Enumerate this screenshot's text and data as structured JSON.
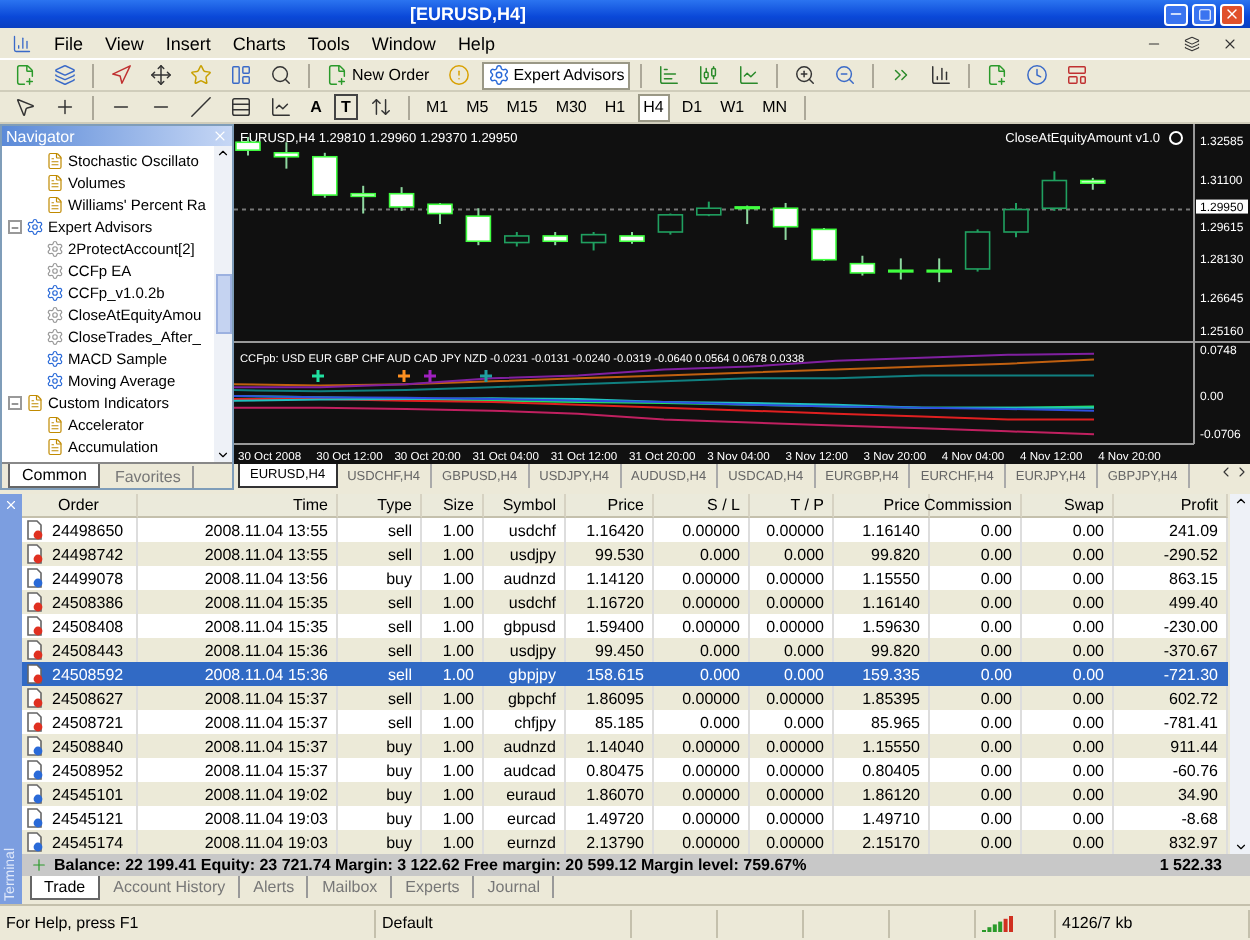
{
  "window": {
    "title": "[EURUSD,H4]"
  },
  "menu": [
    "File",
    "View",
    "Insert",
    "Charts",
    "Tools",
    "Window",
    "Help"
  ],
  "toolbar": {
    "new_order": "New Order",
    "expert_advisors": "Expert Advisors"
  },
  "text_tools": [
    {
      "glyph": "A",
      "boxed": false
    },
    {
      "glyph": "T",
      "boxed": true
    }
  ],
  "timeframes": [
    {
      "label": "M1",
      "selected": false
    },
    {
      "label": "M5",
      "selected": false
    },
    {
      "label": "M15",
      "selected": false
    },
    {
      "label": "M30",
      "selected": false
    },
    {
      "label": "H1",
      "selected": false
    },
    {
      "label": "H4",
      "selected": true
    },
    {
      "label": "D1",
      "selected": false
    },
    {
      "label": "W1",
      "selected": false
    },
    {
      "label": "MN",
      "selected": false
    }
  ],
  "navigator": {
    "title": "Navigator",
    "tree_continued": [
      "Stochastic Oscillato",
      "Volumes",
      "Williams' Percent Ra"
    ],
    "tree": [
      {
        "label": "Expert Advisors",
        "expanded": true,
        "children": [
          {
            "label": "2ProtectAccount[2]",
            "active": false
          },
          {
            "label": "CCFp EA",
            "active": false
          },
          {
            "label": "CCFp_v1.0.2b",
            "active": true
          },
          {
            "label": "CloseAtEquityAmou",
            "active": false
          },
          {
            "label": "CloseTrades_After_",
            "active": false
          },
          {
            "label": "MACD Sample",
            "active": true
          },
          {
            "label": "Moving Average",
            "active": true
          }
        ]
      },
      {
        "label": "Custom Indicators",
        "expanded": true,
        "children": [
          {
            "label": "Accelerator",
            "active": false
          },
          {
            "label": "Accumulation",
            "active": false
          }
        ]
      }
    ],
    "tabs": [
      {
        "label": "Common",
        "selected": true
      },
      {
        "label": "Favorites",
        "selected": false
      }
    ]
  },
  "chart": {
    "header": "EURUSD,H4  1.29810 1.29960 1.29370 1.29950",
    "expert": "CloseAtEquityAmount v1.0",
    "price_labels": [
      "1.32585",
      "1.31100",
      "1.29615",
      "1.28130",
      "1.26645",
      "1.25160"
    ],
    "current_price": "1.29950",
    "indicator": {
      "header": "CCFpb: USD EUR GBP CHF AUD CAD JPY NZD -0.0231 -0.0131 -0.0240 -0.0319 -0.0640 0.0564 0.0678 0.0338",
      "scale": [
        "0.0748",
        "0.00",
        "-0.0706"
      ]
    },
    "time_labels": [
      "30 Oct 2008",
      "30 Oct 12:00",
      "30 Oct 20:00",
      "31 Oct 04:00",
      "31 Oct 12:00",
      "31 Oct 20:00",
      "3 Nov 04:00",
      "3 Nov 12:00",
      "3 Nov 20:00",
      "4 Nov 04:00",
      "4 Nov 12:00",
      "4 Nov 20:00"
    ],
    "tabs": [
      {
        "label": "EURUSD,H4",
        "selected": true
      },
      {
        "label": "USDCHF,H4",
        "selected": false
      },
      {
        "label": "GBPUSD,H4",
        "selected": false
      },
      {
        "label": "USDJPY,H4",
        "selected": false
      },
      {
        "label": "AUDUSD,H4",
        "selected": false
      },
      {
        "label": "USDCAD,H4",
        "selected": false
      },
      {
        "label": "EURGBP,H4",
        "selected": false
      },
      {
        "label": "EURCHF,H4",
        "selected": false
      },
      {
        "label": "EURJPY,H4",
        "selected": false
      },
      {
        "label": "GBPJPY,H4",
        "selected": false
      }
    ]
  },
  "terminal": {
    "side_label": "Terminal",
    "columns": [
      "Order",
      "Time",
      "Type",
      "Size",
      "Symbol",
      "Price",
      "S / L",
      "T / P",
      "Price",
      "Commission",
      "Swap",
      "Profit"
    ],
    "rows": [
      {
        "kind": "sell",
        "selected": false,
        "cells": [
          "24498650",
          "2008.11.04 13:55",
          "sell",
          "1.00",
          "usdchf",
          "1.16420",
          "0.00000",
          "0.00000",
          "1.16140",
          "0.00",
          "0.00",
          "241.09"
        ]
      },
      {
        "kind": "sell",
        "selected": false,
        "cells": [
          "24498742",
          "2008.11.04 13:55",
          "sell",
          "1.00",
          "usdjpy",
          "99.530",
          "0.000",
          "0.000",
          "99.820",
          "0.00",
          "0.00",
          "-290.52"
        ]
      },
      {
        "kind": "buy",
        "selected": false,
        "cells": [
          "24499078",
          "2008.11.04 13:56",
          "buy",
          "1.00",
          "audnzd",
          "1.14120",
          "0.00000",
          "0.00000",
          "1.15550",
          "0.00",
          "0.00",
          "863.15"
        ]
      },
      {
        "kind": "sell",
        "selected": false,
        "cells": [
          "24508386",
          "2008.11.04 15:35",
          "sell",
          "1.00",
          "usdchf",
          "1.16720",
          "0.00000",
          "0.00000",
          "1.16140",
          "0.00",
          "0.00",
          "499.40"
        ]
      },
      {
        "kind": "sell",
        "selected": false,
        "cells": [
          "24508408",
          "2008.11.04 15:35",
          "sell",
          "1.00",
          "gbpusd",
          "1.59400",
          "0.00000",
          "0.00000",
          "1.59630",
          "0.00",
          "0.00",
          "-230.00"
        ]
      },
      {
        "kind": "sell",
        "selected": false,
        "cells": [
          "24508443",
          "2008.11.04 15:36",
          "sell",
          "1.00",
          "usdjpy",
          "99.450",
          "0.000",
          "0.000",
          "99.820",
          "0.00",
          "0.00",
          "-370.67"
        ]
      },
      {
        "kind": "sell",
        "selected": true,
        "cells": [
          "24508592",
          "2008.11.04 15:36",
          "sell",
          "1.00",
          "gbpjpy",
          "158.615",
          "0.000",
          "0.000",
          "159.335",
          "0.00",
          "0.00",
          "-721.30"
        ]
      },
      {
        "kind": "sell",
        "selected": false,
        "cells": [
          "24508627",
          "2008.11.04 15:37",
          "sell",
          "1.00",
          "gbpchf",
          "1.86095",
          "0.00000",
          "0.00000",
          "1.85395",
          "0.00",
          "0.00",
          "602.72"
        ]
      },
      {
        "kind": "sell",
        "selected": false,
        "cells": [
          "24508721",
          "2008.11.04 15:37",
          "sell",
          "1.00",
          "chfjpy",
          "85.185",
          "0.000",
          "0.000",
          "85.965",
          "0.00",
          "0.00",
          "-781.41"
        ]
      },
      {
        "kind": "buy",
        "selected": false,
        "cells": [
          "24508840",
          "2008.11.04 15:37",
          "buy",
          "1.00",
          "audnzd",
          "1.14040",
          "0.00000",
          "0.00000",
          "1.15550",
          "0.00",
          "0.00",
          "911.44"
        ]
      },
      {
        "kind": "buy",
        "selected": false,
        "cells": [
          "24508952",
          "2008.11.04 15:37",
          "buy",
          "1.00",
          "audcad",
          "0.80475",
          "0.00000",
          "0.00000",
          "0.80405",
          "0.00",
          "0.00",
          "-60.76"
        ]
      },
      {
        "kind": "buy",
        "selected": false,
        "cells": [
          "24545101",
          "2008.11.04 19:02",
          "buy",
          "1.00",
          "euraud",
          "1.86070",
          "0.00000",
          "0.00000",
          "1.86120",
          "0.00",
          "0.00",
          "34.90"
        ]
      },
      {
        "kind": "buy",
        "selected": false,
        "cells": [
          "24545121",
          "2008.11.04 19:03",
          "buy",
          "1.00",
          "eurcad",
          "1.49720",
          "0.00000",
          "0.00000",
          "1.49710",
          "0.00",
          "0.00",
          "-8.68"
        ]
      },
      {
        "kind": "buy",
        "selected": false,
        "cells": [
          "24545174",
          "2008.11.04 19:03",
          "buy",
          "1.00",
          "eurnzd",
          "2.13790",
          "0.00000",
          "0.00000",
          "2.15170",
          "0.00",
          "0.00",
          "832.97"
        ]
      }
    ],
    "summary": "Balance: 22 199.41  Equity: 23 721.74  Margin: 3 122.62  Free margin: 20 599.12  Margin level: 759.67%",
    "total": "1 522.33",
    "tabs": [
      {
        "label": "Trade",
        "selected": true
      },
      {
        "label": "Account History",
        "selected": false
      },
      {
        "label": "Alerts",
        "selected": false
      },
      {
        "label": "Mailbox",
        "selected": false
      },
      {
        "label": "Experts",
        "selected": false
      },
      {
        "label": "Journal",
        "selected": false
      }
    ]
  },
  "status_bar": {
    "help": "For Help, press F1",
    "profile": "Default",
    "traffic": "4126/7 kb"
  }
}
